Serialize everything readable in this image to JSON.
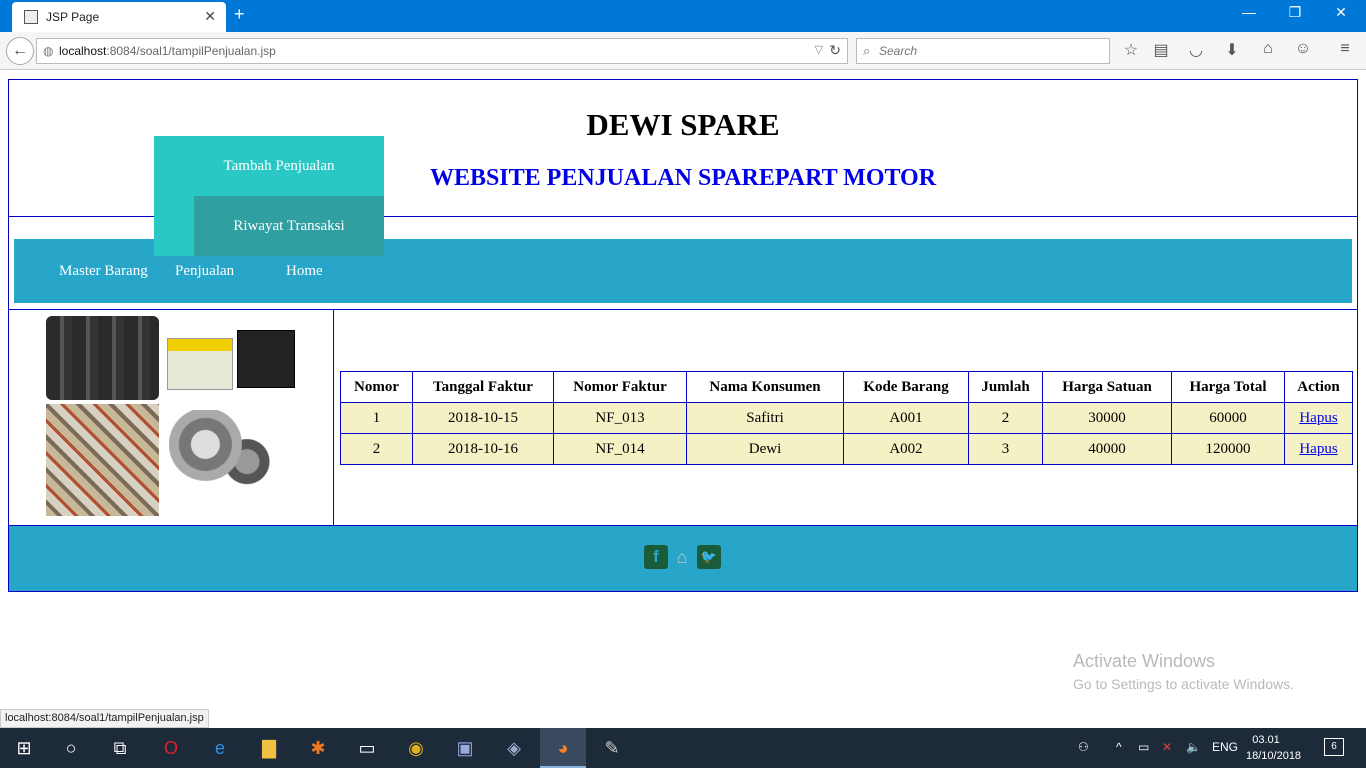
{
  "browser": {
    "tab_title": "JSP Page",
    "tab_close": "✕",
    "new_tab": "+",
    "win_minimize": "—",
    "win_restore": "❐",
    "win_close": "✕",
    "url_host": "localhost",
    "url_rest": ":8084/soal1/tampilPenjualan.jsp",
    "search_placeholder": "Search"
  },
  "header": {
    "title": "DEWI SPARE",
    "subtitle": "WEBSITE PENJUALAN SPAREPART MOTOR"
  },
  "menu": {
    "items": [
      {
        "label": "Master Barang"
      },
      {
        "label": "Penjualan"
      },
      {
        "label": "Home"
      }
    ],
    "dropdown": [
      {
        "label": "Tambah Penjualan"
      },
      {
        "label": "Riwayat Transaksi"
      }
    ]
  },
  "table": {
    "headers": [
      "Nomor",
      "Tanggal Faktur",
      "Nomor Faktur",
      "Nama Konsumen",
      "Kode Barang",
      "Jumlah",
      "Harga Satuan",
      "Harga Total",
      "Action"
    ],
    "rows": [
      {
        "nomor": "1",
        "tanggal": "2018-10-15",
        "faktur": "NF_013",
        "konsumen": "Safitri",
        "kode": "A001",
        "jumlah": "2",
        "satuan": "30000",
        "total": "60000",
        "action": "Hapus"
      },
      {
        "nomor": "2",
        "tanggal": "2018-10-16",
        "faktur": "NF_014",
        "konsumen": "Dewi",
        "kode": "A002",
        "jumlah": "3",
        "satuan": "40000",
        "total": "120000",
        "action": "Hapus"
      }
    ]
  },
  "footer": {
    "icons": [
      "facebook-icon",
      "home-icon",
      "twitter-icon"
    ]
  },
  "watermark": {
    "title": "Activate Windows",
    "subtitle": "Go to Settings to activate Windows."
  },
  "status_bar": "localhost:8084/soal1/tampilPenjualan.jsp",
  "taskbar": {
    "language": "ENG",
    "time": "03.01",
    "date": "18/10/2018",
    "notifications": "6"
  },
  "colors": {
    "menu_bg": "#27a6c9",
    "dropdown_bg": "#29c8c5",
    "dropdown_hover": "#2f9fa2",
    "subtitle": "#0000e6",
    "row_bg": "#f4f1c4",
    "border": "#0000c8"
  }
}
